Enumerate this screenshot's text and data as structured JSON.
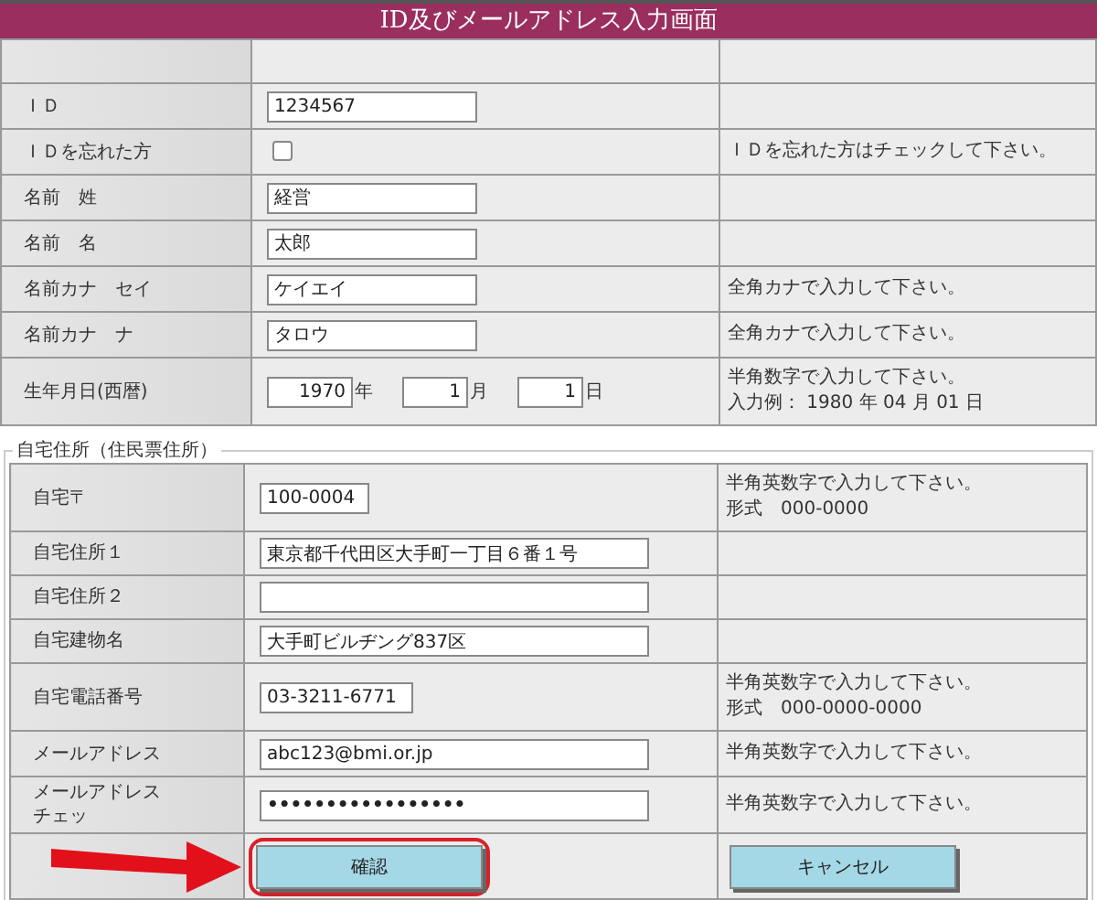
{
  "title": "ID及びメールアドレス入力画面",
  "sections": [
    {
      "rows": [
        {
          "kind": "blank"
        },
        {
          "kind": "short",
          "label": [
            "ＩＤ"
          ],
          "value": "1234567"
        },
        {
          "kind": "checkbox",
          "label": [
            "ＩＤを忘れた方"
          ],
          "checked": false,
          "hint": [
            "ＩＤを忘れた方はチェックして下さい。"
          ]
        },
        {
          "kind": "short",
          "label": [
            "名前　姓"
          ],
          "value": "経営"
        },
        {
          "kind": "short",
          "label": [
            "名前　名"
          ],
          "value": "太郎"
        },
        {
          "kind": "short",
          "label": [
            "名前カナ　セイ"
          ],
          "value": "ケイエイ",
          "hint": [
            "全角カナで入力して下さい。"
          ]
        },
        {
          "kind": "short",
          "label": [
            "名前カナ　ナ"
          ],
          "value": "タロウ",
          "hint": [
            "全角カナで入力して下さい。"
          ]
        },
        {
          "kind": "date",
          "label": [
            "生年月日(西暦)"
          ],
          "parts": [
            {
              "value": "1970",
              "unit": "年"
            },
            {
              "value": "1",
              "unit": "月"
            },
            {
              "value": "1",
              "unit": "日"
            }
          ],
          "hint": [
            "半角数字で入力して下さい。",
            "入力例： 1980 年 04 月 01 日"
          ]
        }
      ]
    },
    {
      "legend": "自宅住所（住民票住所）",
      "rows": [
        {
          "kind": "tiny",
          "label": [
            "自宅〒"
          ],
          "value": "100-0004",
          "hint": [
            "半角英数字で入力して下さい。",
            "形式　000-0000"
          ]
        },
        {
          "kind": "long",
          "label": [
            "自宅住所１"
          ],
          "value": "東京都千代田区大手町一丁目６番１号"
        },
        {
          "kind": "long",
          "label": [
            "自宅住所２"
          ]
        },
        {
          "kind": "long",
          "label": [
            "自宅建物名"
          ],
          "value": "大手町ビルヂング837区"
        },
        {
          "kind": "mid",
          "label": [
            "自宅電話番号"
          ],
          "value": "03-3211-6771",
          "hint": [
            "半角英数字で入力して下さい。",
            "形式　000-0000-0000"
          ]
        },
        {
          "kind": "long",
          "label": [
            "メールアドレス"
          ],
          "value": "abc123@bmi.or.jp",
          "hint": [
            "半角英数字で入力して下さい。"
          ]
        },
        {
          "kind": "password",
          "label": [
            "メールアドレス",
            "チェッ"
          ],
          "value": "•••••••••••••••••",
          "hint": [
            "半角英数字で入力して下さい。"
          ]
        },
        {
          "kind": "buttons",
          "buttons": [
            {
              "label": "確認",
              "highlighted": true
            },
            {
              "label": "キャンセル",
              "highlighted": false
            }
          ]
        }
      ]
    }
  ]
}
